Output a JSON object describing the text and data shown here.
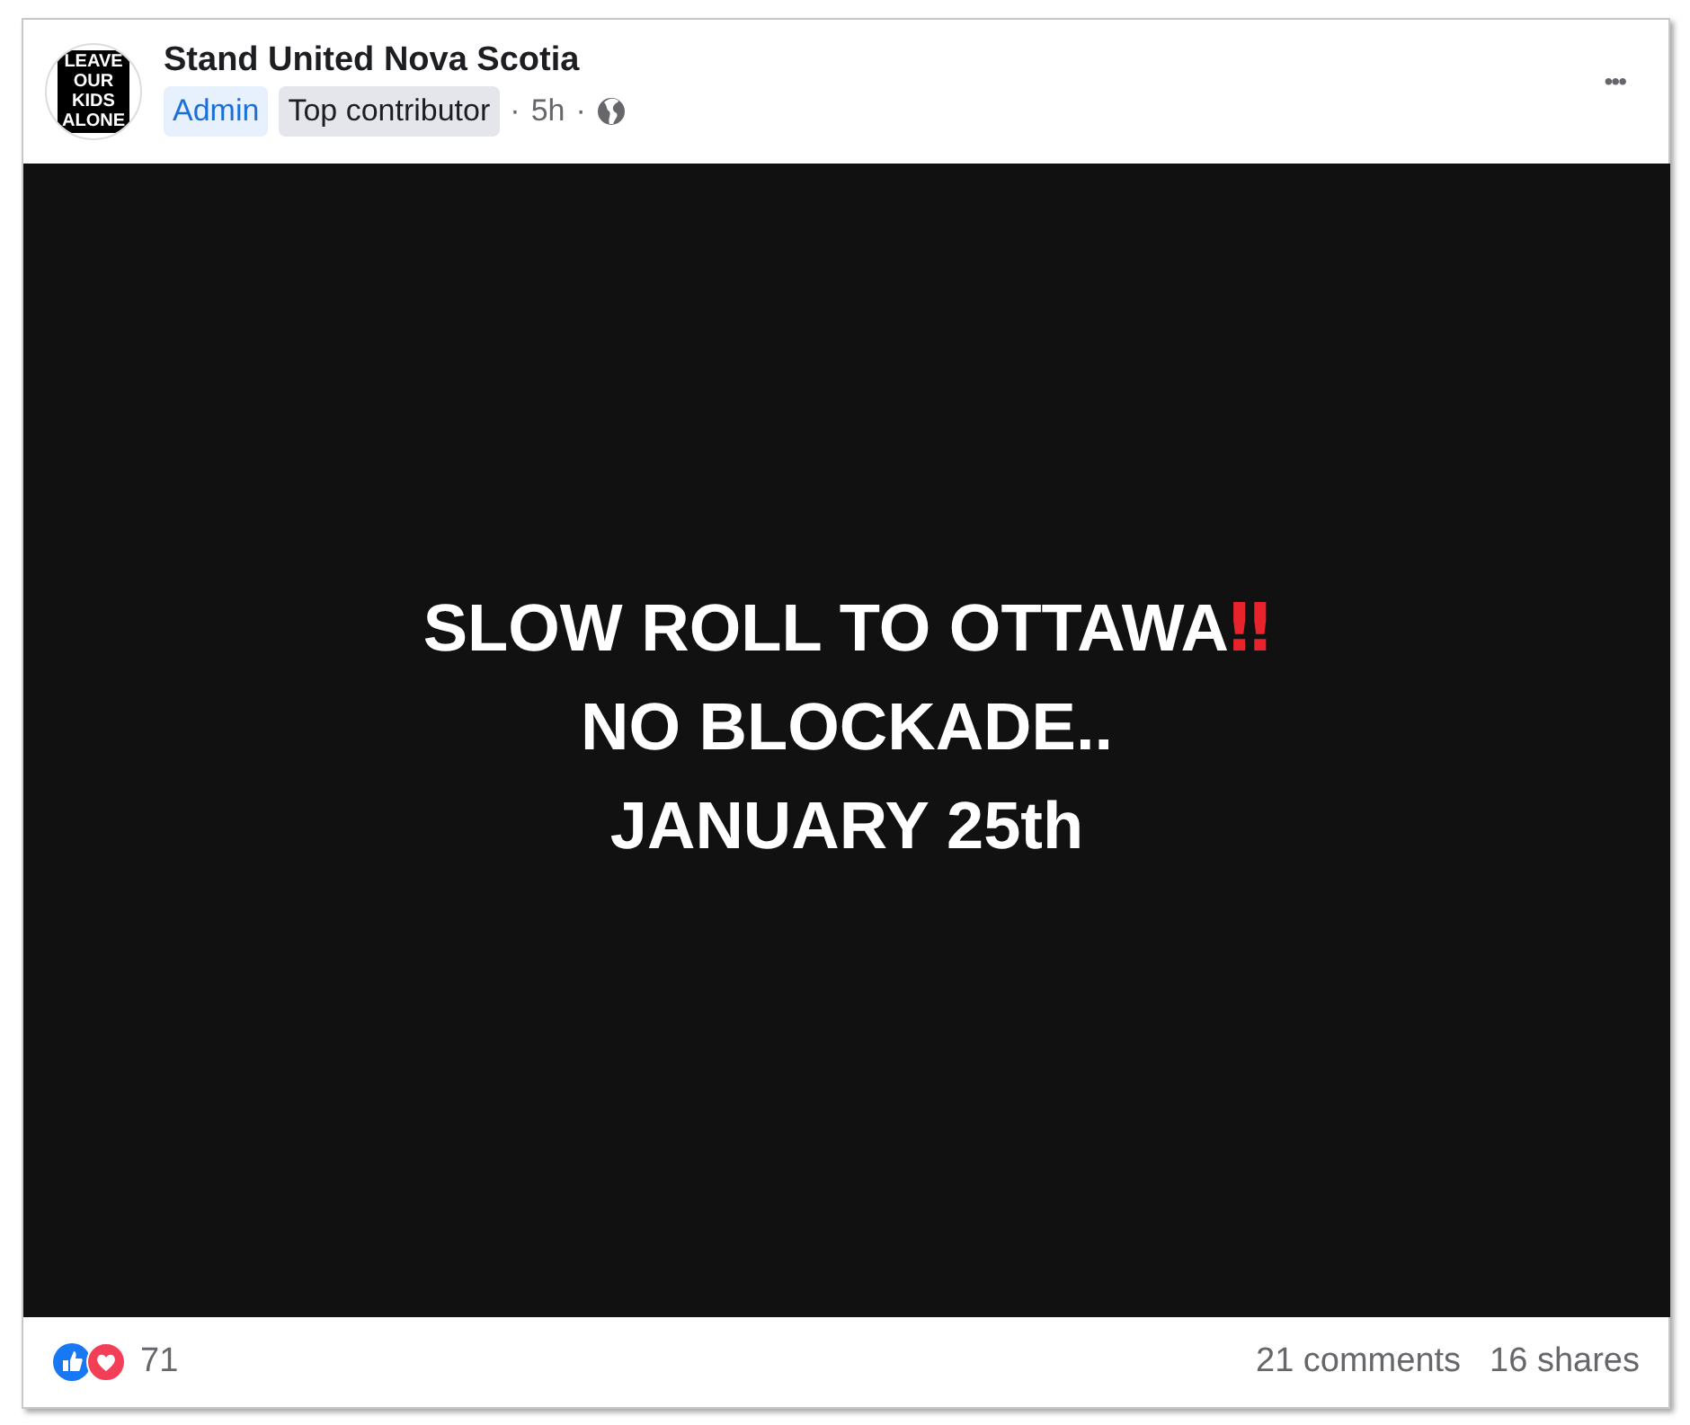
{
  "post": {
    "author": "Stand United Nova Scotia",
    "avatar_lines": [
      "LEAVE",
      "OUR",
      "KIDS",
      "ALONE"
    ],
    "badges": [
      {
        "label": "Admin",
        "kind": "role"
      },
      {
        "label": "Top contributor",
        "kind": "status"
      }
    ],
    "time": "5h",
    "separator": "·",
    "more": "•••",
    "image_lines": [
      {
        "text": "SLOW ROLL TO OTTAWA",
        "emoji": "‼"
      },
      {
        "text": "NO BLOCKADE.."
      },
      {
        "text": "JANUARY 25th"
      }
    ],
    "reaction_count": "71",
    "comments": "21 comments",
    "shares": "16 shares"
  }
}
